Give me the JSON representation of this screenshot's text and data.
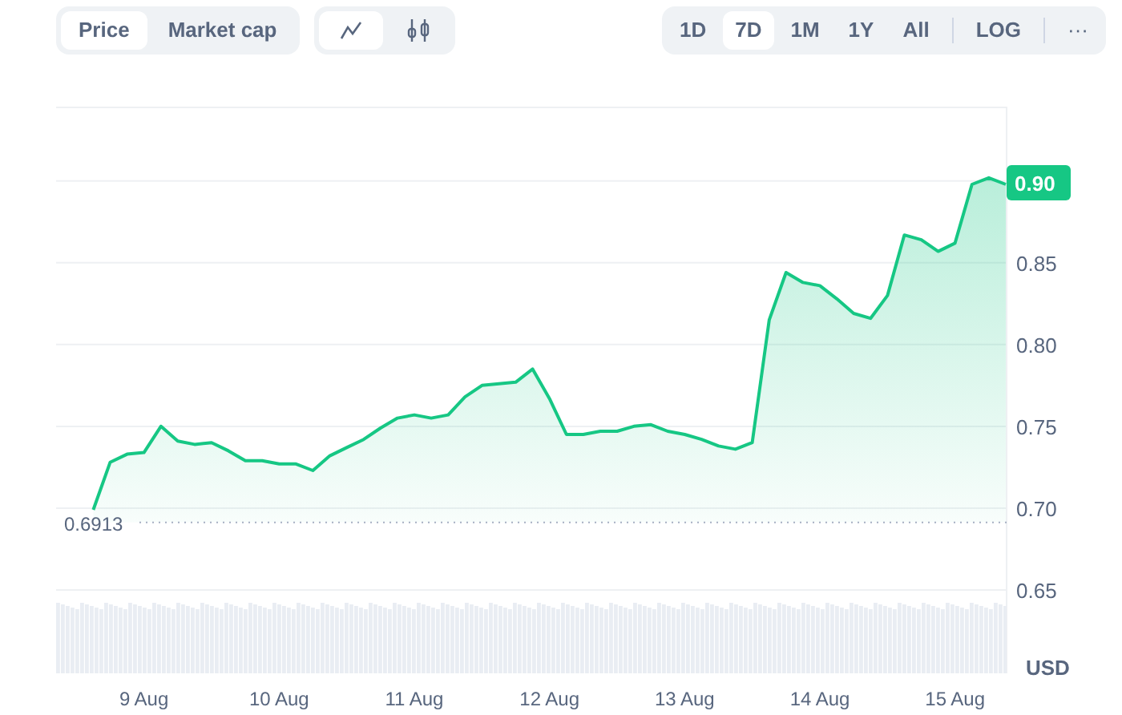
{
  "metric_tabs": [
    {
      "label": "Price",
      "selected": true
    },
    {
      "label": "Market cap",
      "selected": false
    }
  ],
  "chart_type_tabs": [
    {
      "kind": "line",
      "selected": true
    },
    {
      "kind": "candles",
      "selected": false
    }
  ],
  "range_tabs": [
    {
      "label": "1D",
      "selected": false
    },
    {
      "label": "7D",
      "selected": true
    },
    {
      "label": "1M",
      "selected": false
    },
    {
      "label": "1Y",
      "selected": false
    },
    {
      "label": "All",
      "selected": false
    }
  ],
  "scale_button": "LOG",
  "more_button": "···",
  "chart": {
    "current_price": "0.90",
    "currency": "USD",
    "chart_data": {
      "type": "area",
      "grid": true,
      "ref_lines": [
        {
          "axis": "y",
          "value": 0.6913,
          "label": "0.6913"
        }
      ],
      "categories": [
        null,
        null,
        null,
        "9 Aug",
        null,
        null,
        null,
        null,
        null,
        null,
        null,
        "10 Aug",
        null,
        null,
        null,
        null,
        null,
        null,
        null,
        "11 Aug",
        null,
        null,
        null,
        null,
        null,
        null,
        null,
        "12 Aug",
        null,
        null,
        null,
        null,
        null,
        null,
        null,
        "13 Aug",
        null,
        null,
        null,
        null,
        null,
        null,
        null,
        "14 Aug",
        null,
        null,
        null,
        null,
        null,
        null,
        null,
        "15 Aug",
        null,
        null,
        null
      ],
      "series": [
        {
          "color": "#16c784",
          "values": [
            0.699,
            0.728,
            0.733,
            0.734,
            0.75,
            0.741,
            0.739,
            0.74,
            0.735,
            0.729,
            0.729,
            0.727,
            0.727,
            0.723,
            0.732,
            0.737,
            0.742,
            0.749,
            0.755,
            0.757,
            0.755,
            0.757,
            0.768,
            0.775,
            0.776,
            0.777,
            0.785,
            0.767,
            0.745,
            0.745,
            0.747,
            0.747,
            0.75,
            0.751,
            0.747,
            0.745,
            0.742,
            0.738,
            0.736,
            0.74,
            0.815,
            0.844,
            0.838,
            0.836,
            0.828,
            0.819,
            0.816,
            0.83,
            0.867,
            0.864,
            0.857,
            0.862,
            0.898,
            0.902,
            0.898
          ]
        }
      ],
      "ylim": [
        0.599,
        0.945
      ],
      "yticks": [
        {
          "value": 0.65,
          "label": "0.65"
        },
        {
          "value": 0.7,
          "label": "0.70"
        },
        {
          "value": 0.75,
          "label": "0.75"
        },
        {
          "value": 0.8,
          "label": "0.80"
        },
        {
          "value": 0.85,
          "label": "0.85"
        },
        {
          "value": 0.9,
          "label": "0.90"
        }
      ]
    }
  }
}
